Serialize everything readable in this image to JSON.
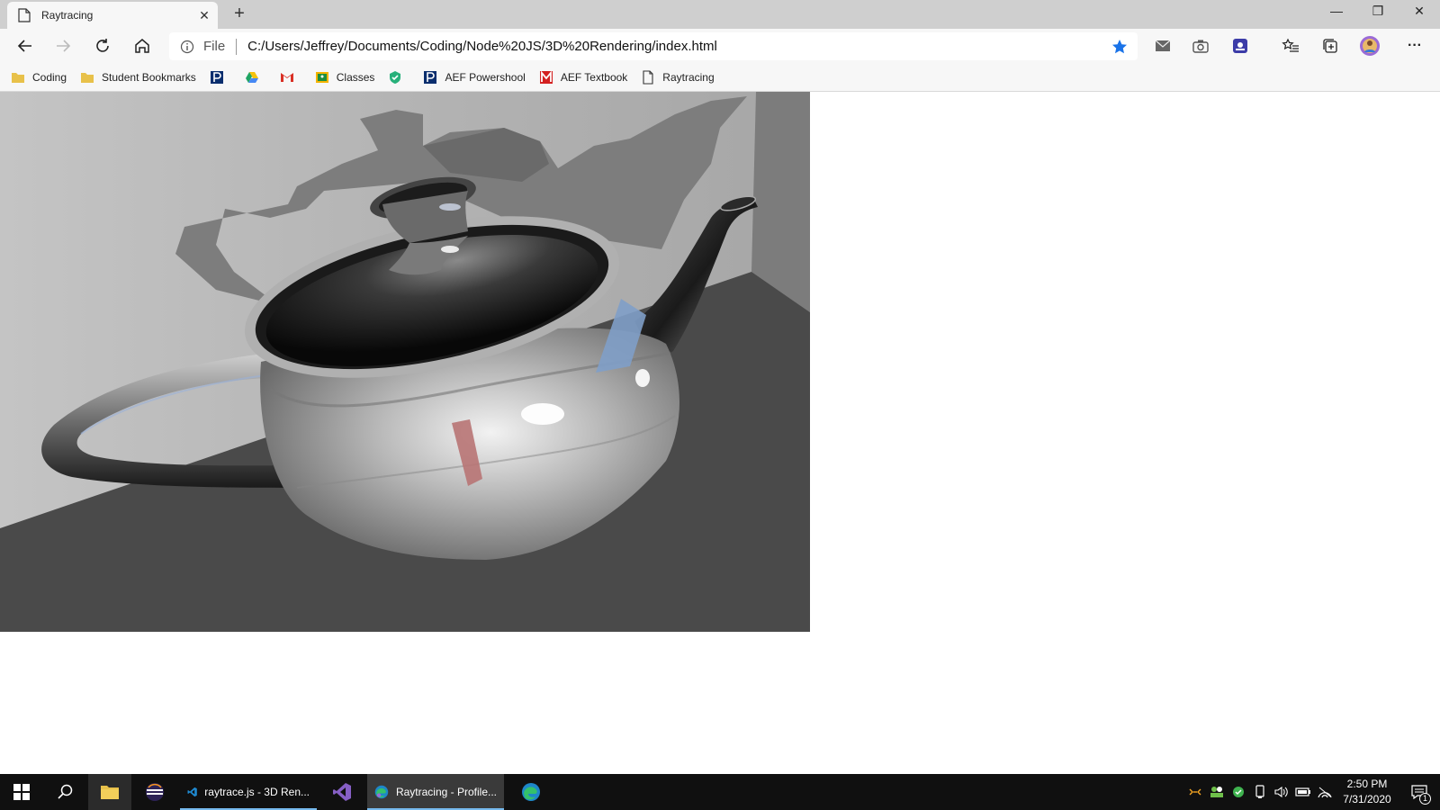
{
  "browser": {
    "tab_title": "Raytracing",
    "tab_close": "✕",
    "new_tab": "+",
    "window_controls": {
      "minimize": "—",
      "restore": "❐",
      "close": "✕"
    },
    "address": {
      "protocol_label": "File",
      "url": "C:/Users/Jeffrey/Documents/Coding/Node%20JS/3D%20Rendering/index.html"
    },
    "more_label": "···",
    "bookmarks": [
      {
        "label": "Coding",
        "icon": "folder-icon"
      },
      {
        "label": "Student Bookmarks",
        "icon": "folder-icon"
      },
      {
        "label": "",
        "icon": "powerschool-icon"
      },
      {
        "label": "",
        "icon": "drive-icon"
      },
      {
        "label": "",
        "icon": "gmail-icon"
      },
      {
        "label": "Classes",
        "icon": "classroom-icon"
      },
      {
        "label": "",
        "icon": "shield-check-icon"
      },
      {
        "label": "AEF Powershool",
        "icon": "powerschool-icon"
      },
      {
        "label": "AEF Textbook",
        "icon": "mcgraw-icon"
      },
      {
        "label": "Raytracing",
        "icon": "page-icon"
      }
    ]
  },
  "colors": {
    "accent": "#1a73e8",
    "taskbar": "#101010",
    "active_underline": "#76b9ed"
  },
  "taskbar": {
    "apps": [
      {
        "label": "raytrace.js - 3D Ren..."
      },
      {
        "label": "Raytracing - Profile..."
      }
    ],
    "clock": {
      "time": "2:50 PM",
      "date": "7/31/2020"
    },
    "notification_count": "1"
  }
}
